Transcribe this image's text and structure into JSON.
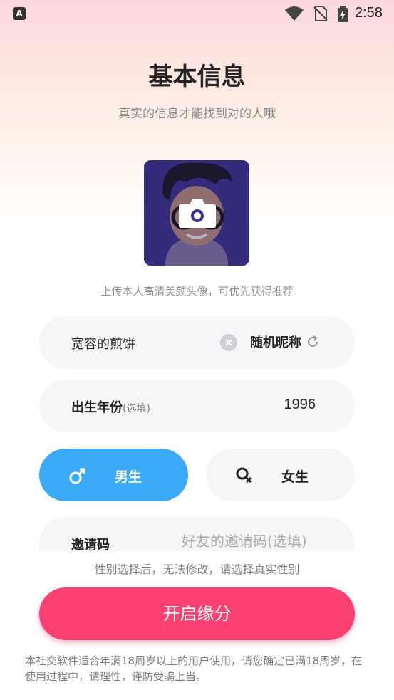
{
  "status_bar": {
    "app_icon_letter": "A",
    "time": "2:58"
  },
  "header": {
    "title": "基本信息",
    "subtitle": "真实的信息才能找到对的人哦"
  },
  "avatar": {
    "icon": "camera-icon",
    "upload_hint": "上传本人高清美颜头像，可优先获得推荐"
  },
  "nickname": {
    "value": "宽容的煎饼",
    "random_label": "随机昵称"
  },
  "birth_year": {
    "label": "出生年份",
    "optional_tag": "(选填)",
    "value": "1996"
  },
  "gender": {
    "male_label": "男生",
    "female_label": "女生",
    "selected": "male"
  },
  "invite": {
    "label": "邀请码",
    "placeholder": "好友的邀请码(选填)"
  },
  "gender_note": "性别选择后，无法修改，请选择真实性别",
  "submit_label": "开启缘分",
  "disclaimer": "本社交软件适合年满18周岁以上的用户使用，请您确定已满18周岁，在使用过程中，请理性，谨防受骗上当。",
  "colors": {
    "accent_blue": "#3aaaf8",
    "accent_pink": "#fb4172",
    "field_bg": "#f5f6f8"
  }
}
